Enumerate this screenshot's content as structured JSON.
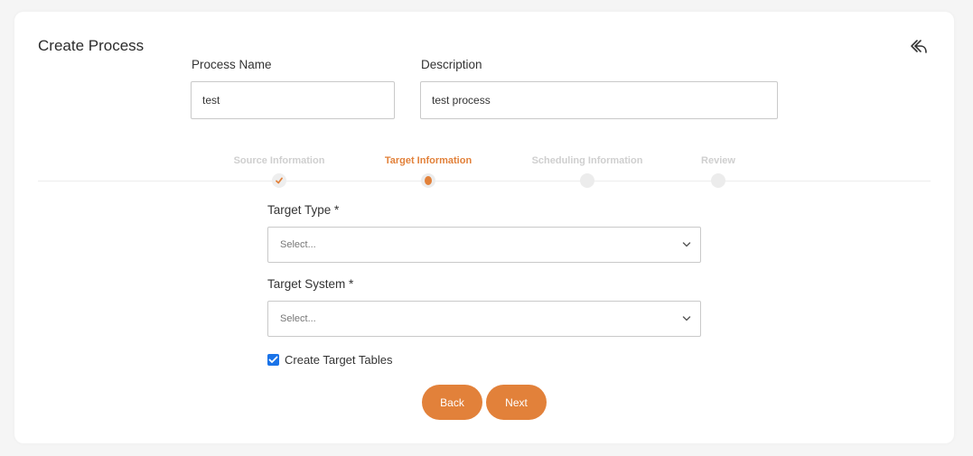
{
  "header": {
    "title": "Create Process",
    "back_icon": "reply-arrow-icon"
  },
  "form": {
    "process_name": {
      "label": "Process Name",
      "value": "test"
    },
    "description": {
      "label": "Description",
      "value": "test process"
    }
  },
  "stepper": {
    "steps": [
      {
        "label": "Source Information",
        "state": "completed"
      },
      {
        "label": "Target Information",
        "state": "active"
      },
      {
        "label": "Scheduling Information",
        "state": "pending"
      },
      {
        "label": "Review",
        "state": "pending"
      }
    ]
  },
  "target": {
    "target_type": {
      "label": "Target Type *",
      "placeholder": "Select..."
    },
    "target_system": {
      "label": "Target System *",
      "placeholder": "Select..."
    },
    "create_tables": {
      "label": "Create Target Tables",
      "checked": true
    }
  },
  "actions": {
    "back_label": "Back",
    "next_label": "Next"
  },
  "colors": {
    "accent": "#e2813a",
    "checkbox": "#1a73e8",
    "card": "#ffffff",
    "background": "#f5f5f5"
  }
}
